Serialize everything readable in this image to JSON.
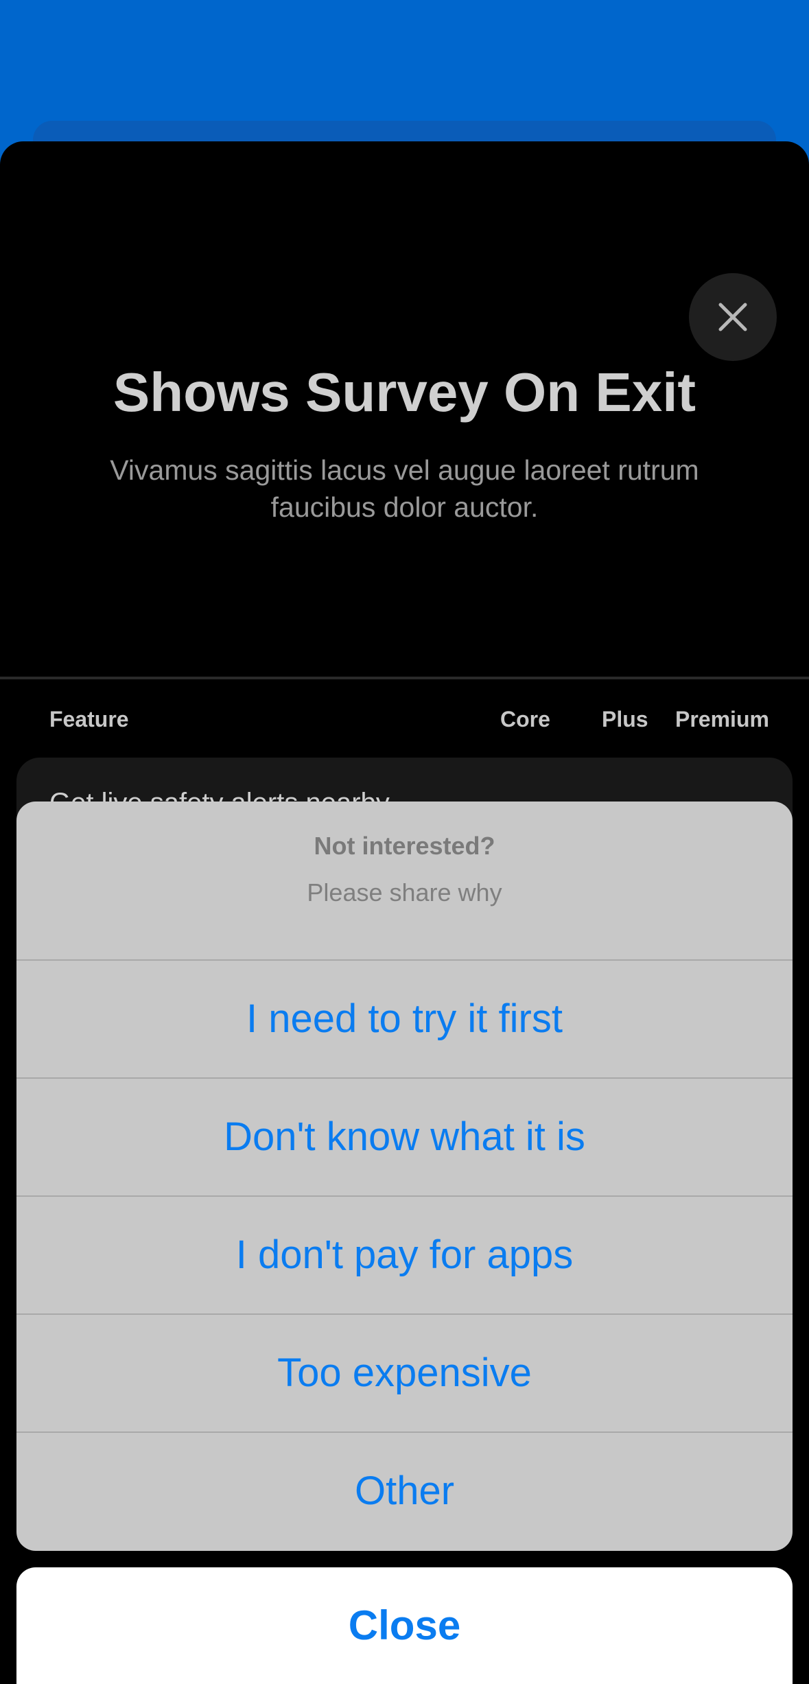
{
  "paywall": {
    "title": "Shows Survey On Exit",
    "subtitle": "Vivamus sagittis lacus vel augue laoreet rutrum faucibus dolor auctor.",
    "table": {
      "headers": [
        "Feature",
        "Core",
        "Plus",
        "Premium"
      ],
      "rows": [
        "Get live safety alerts nearby"
      ]
    },
    "close_icon": "close-icon"
  },
  "action_sheet": {
    "title": "Not interested?",
    "message": "Please share why",
    "options": [
      "I need to try it first",
      "Don't know what it is",
      "I don't pay for apps",
      "Too expensive",
      "Other"
    ],
    "cancel_label": "Close"
  },
  "colors": {
    "accent": "#0a7cf0",
    "background_blue": "#0066cc",
    "sheet_gray": "#c8c8c8"
  }
}
